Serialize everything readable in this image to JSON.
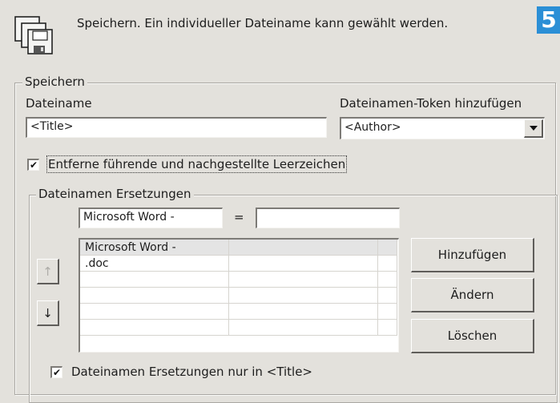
{
  "header": {
    "description": "Speichern. Ein individueller Dateiname kann gewählt werden.",
    "step_number": "5"
  },
  "save_group": {
    "legend": "Speichern",
    "filename_label": "Dateiname",
    "filename_value": "<Title>",
    "token_label": "Dateinamen-Token hinzufügen",
    "token_selected": "<Author>",
    "trim_checkbox_label": "Entferne führende und nachgestellte Leerzeichen",
    "trim_checked": true
  },
  "replace_group": {
    "legend": "Dateinamen Ersetzungen",
    "search_value": "Microsoft Word -",
    "equals_sign": "=",
    "replace_value": "",
    "rows": [
      {
        "search": "Microsoft Word -",
        "replace": ""
      },
      {
        "search": ".doc",
        "replace": ""
      },
      {
        "search": "",
        "replace": ""
      },
      {
        "search": "",
        "replace": ""
      },
      {
        "search": "",
        "replace": ""
      },
      {
        "search": "",
        "replace": ""
      }
    ],
    "up_arrow": "↑",
    "down_arrow": "↓",
    "add_button": "Hinzufügen",
    "change_button": "Ändern",
    "delete_button": "Löschen",
    "title_only_label": "Dateinamen Ersetzungen nur in <Title>",
    "title_only_checked": true
  },
  "icons": {
    "app": "save-floppy-stack-icon",
    "dropdown": "chevron-down-icon",
    "check": "checkmark-icon"
  },
  "colors": {
    "background": "#e3e1dc",
    "badge": "#2b8fd6"
  }
}
